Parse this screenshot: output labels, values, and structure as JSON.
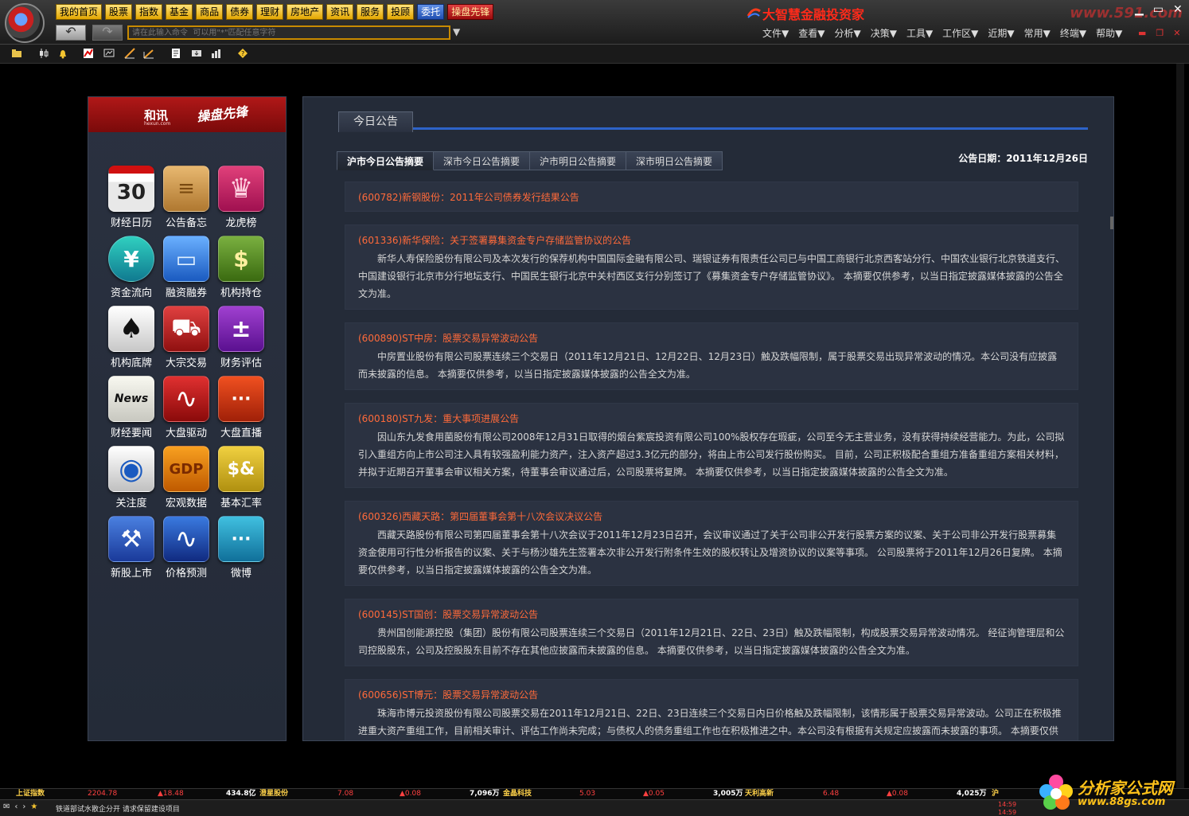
{
  "top_nav": [
    "我的首页",
    "股票",
    "指数",
    "基金",
    "商品",
    "债券",
    "理财",
    "房地产",
    "资讯",
    "服务",
    "投顾",
    "委托",
    "操盘先锋"
  ],
  "command_placeholder": "请在此输入命令  可以用\"*\"匹配任意字符",
  "brand_title": "大智慧金融投资家",
  "brand_logo": "www.591.com",
  "menu": [
    "文件▼",
    "查看▼",
    "分析▼",
    "决策▼",
    "工具▼",
    "工作区▼",
    "近期▼",
    "常用▼",
    "终端▼",
    "帮助▼"
  ],
  "left_panel": {
    "hexun": "和讯",
    "hexun_sub": "hexun.com",
    "caopan": "操盘先锋",
    "apps": [
      {
        "label": "财经日历",
        "icon": "calendar-icon",
        "glyph": "30"
      },
      {
        "label": "公告备忘",
        "icon": "notepad-icon",
        "glyph": "≡"
      },
      {
        "label": "龙虎榜",
        "icon": "crown-icon",
        "glyph": "♛"
      },
      {
        "label": "资金流向",
        "icon": "cash-flow-icon",
        "glyph": "¥"
      },
      {
        "label": "融资融券",
        "icon": "credit-card-icon",
        "glyph": "▭"
      },
      {
        "label": "机构持仓",
        "icon": "money-bag-icon",
        "glyph": "$"
      },
      {
        "label": "机构底牌",
        "icon": "spade-card-icon",
        "glyph": "♠"
      },
      {
        "label": "大宗交易",
        "icon": "shopping-cart-icon",
        "glyph": "⛟"
      },
      {
        "label": "财务评估",
        "icon": "calculator-icon",
        "glyph": "±"
      },
      {
        "label": "财经要闻",
        "icon": "news-icon",
        "glyph": "News"
      },
      {
        "label": "大盘驱动",
        "icon": "pulse-icon",
        "glyph": "∿"
      },
      {
        "label": "大盘直播",
        "icon": "chat-bubble-icon",
        "glyph": "···"
      },
      {
        "label": "关注度",
        "icon": "eye-icon",
        "glyph": "◉"
      },
      {
        "label": "宏观数据",
        "icon": "gdp-icon",
        "glyph": "GDP"
      },
      {
        "label": "基本汇率",
        "icon": "currency-icon",
        "glyph": "$&"
      },
      {
        "label": "新股上市",
        "icon": "gavel-icon",
        "glyph": "⚒"
      },
      {
        "label": "价格预测",
        "icon": "wave-icon",
        "glyph": "∿"
      },
      {
        "label": "微博",
        "icon": "speech-bubble-icon",
        "glyph": "···"
      }
    ]
  },
  "main": {
    "tab": "今日公告",
    "sub_tabs": [
      "沪市今日公告摘要",
      "深市今日公告摘要",
      "沪市明日公告摘要",
      "深市明日公告摘要"
    ],
    "date": "公告日期：2011年12月26日",
    "announcements": [
      {
        "title": "(600782)新钢股份：2011年公司债券发行结果公告",
        "body": ""
      },
      {
        "title": "(601336)新华保险：关于签署募集资金专户存储监管协议的公告",
        "body": "新华人寿保险股份有限公司及本次发行的保荐机构中国国际金融有限公司、瑞银证券有限责任公司已与中国工商银行北京西客站分行、中国农业银行北京铁道支行、中国建设银行北京市分行地坛支行、中国民生银行北京中关村西区支行分别签订了《募集资金专户存储监管协议》。 本摘要仅供参考，以当日指定披露媒体披露的公告全文为准。"
      },
      {
        "title": "(600890)ST中房：股票交易异常波动公告",
        "body": "中房置业股份有限公司股票连续三个交易日（2011年12月21日、12月22日、12月23日）触及跌幅限制，属于股票交易出现异常波动的情况。本公司没有应披露而未披露的信息。 本摘要仅供参考，以当日指定披露媒体披露的公告全文为准。"
      },
      {
        "title": "(600180)ST九发：重大事项进展公告",
        "body": "因山东九发食用菌股份有限公司2008年12月31日取得的烟台紫宸投资有限公司100%股权存在瑕疵，公司至今无主营业务，没有获得持续经营能力。为此，公司拟引入重组方向上市公司注入具有较强盈利能力资产，注入资产超过3.3亿元的部分，将由上市公司发行股份购买。      目前，公司正积极配合重组方准备重组方案相关材料，并拟于近期召开董事会审议相关方案，待董事会审议通过后，公司股票将复牌。 本摘要仅供参考，以当日指定披露媒体披露的公告全文为准。"
      },
      {
        "title": "(600326)西藏天路：第四届董事会第十八次会议决议公告",
        "body": "西藏天路股份有限公司第四届董事会第十八次会议于2011年12月23日召开，会议审议通过了关于公司非公开发行股票方案的议案、关于公司非公开发行股票募集资金使用可行性分析报告的议案、关于与杨沙雄先生签署本次非公开发行附条件生效的股权转让及增资协议的议案等事项。      公司股票将于2011年12月26日复牌。 本摘要仅供参考，以当日指定披露媒体披露的公告全文为准。"
      },
      {
        "title": "(600145)ST国创：股票交易异常波动公告",
        "body": "贵州国创能源控股（集团）股份有限公司股票连续三个交易日（2011年12月21日、22日、23日）触及跌幅限制，构成股票交易异常波动情况。 经征询管理层和公司控股股东，公司及控股股东目前不存在其他应披露而未披露的信息。 本摘要仅供参考，以当日指定披露媒体披露的公告全文为准。"
      },
      {
        "title": "(600656)ST博元：股票交易异常波动公告",
        "body": "珠海市博元投资股份有限公司股票交易在2011年12月21日、22日、23日连续三个交易日内日价格触及跌幅限制，该情形属于股票交易异常波动。公司正在积极推进重大资产重组工作，目前相关审计、评估工作尚未完成；与债权人的债务重组工作也在积极推进之中。本公司没有根据有关规定应披露而未披露的事项。 本摘要仅供参考，以当日指定披露媒体披露的公告全文为准。"
      }
    ]
  },
  "ticker": {
    "index_name": "上证指数",
    "index_value": "2204.78",
    "index_change": "▲18.48",
    "index_volume": "434.8亿",
    "stocks": [
      {
        "name": "澄星股份",
        "price": "7.08",
        "change": "▲0.08",
        "volume": "7,096万"
      },
      {
        "name": "金晶科技",
        "price": "5.03",
        "change": "▲0.05",
        "volume": "3,005万"
      },
      {
        "name": "天利高新",
        "price": "6.48",
        "change": "▲0.08",
        "volume": "4,025万"
      }
    ],
    "trailing": "沪"
  },
  "status": {
    "news": "铁道部试水散企分开 请求保留建设项目",
    "time1": "14:59",
    "time2": "14:59"
  },
  "footer_logo": {
    "title": "分析家公式网",
    "url": "www.88gs.com"
  },
  "colors": {
    "accent_blue": "#2d63c9",
    "announcement_title": "#ff6a3a",
    "nav_gold": "#e2a600",
    "brand_red": "#ff2a1a"
  }
}
